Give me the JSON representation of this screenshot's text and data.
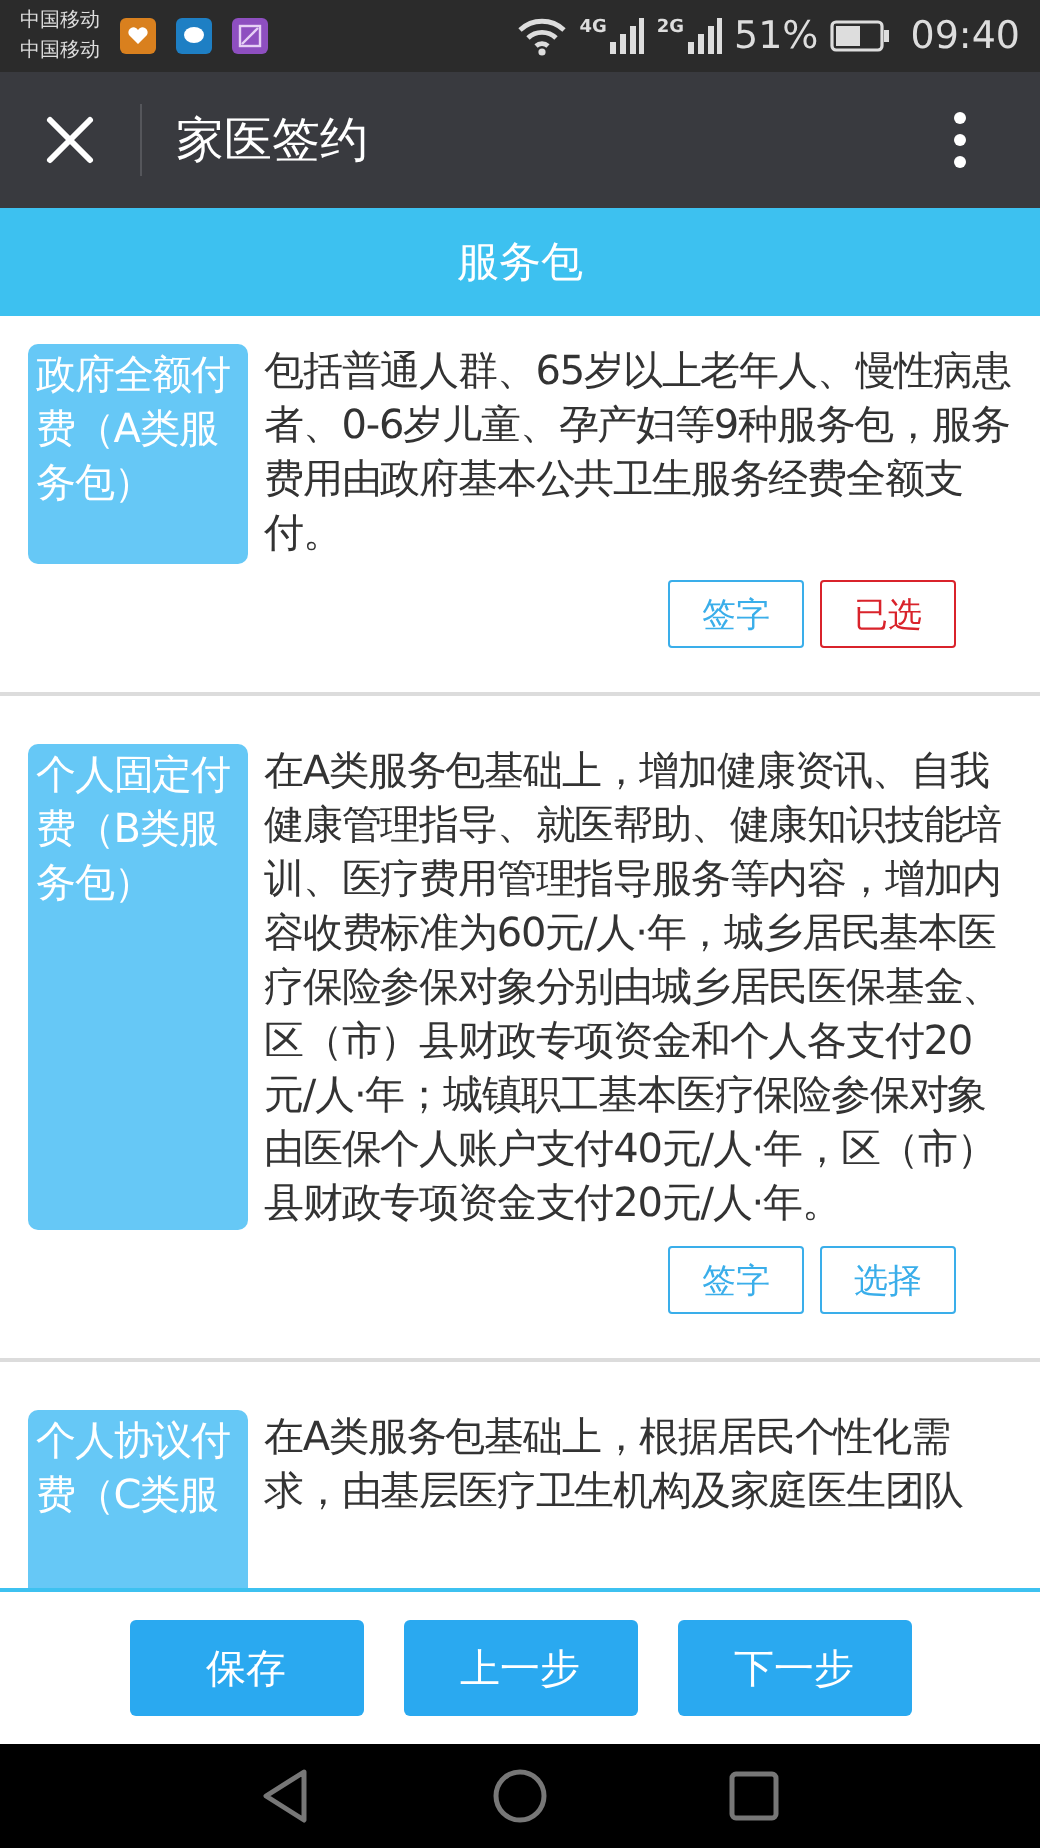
{
  "status_bar": {
    "carriers": [
      "中国移动",
      "中国移动"
    ],
    "network_1": "4G",
    "network_2": "2G",
    "battery": "51%",
    "time": "09:40"
  },
  "header": {
    "title": "家医签约"
  },
  "section_title": "服务包",
  "packages": [
    {
      "label": "政府全额付费（A类服务包）",
      "description": "包括普通人群、65岁以上老年人、慢性病患者、0-6岁儿童、孕产妇等9种服务包，服务费用由政府基本公共卫生服务经费全额支付。",
      "sign_button": "签字",
      "select_button": {
        "label": "已选",
        "selected": true
      }
    },
    {
      "label": "个人固定付费（B类服务包）",
      "description": "在A类服务包基础上，增加健康资讯、自我健康管理指导、就医帮助、健康知识技能培训、医疗费用管理指导服务等内容，增加内容收费标准为60元/人·年，城乡居民基本医疗保险参保对象分别由城乡居民医保基金、区（市）县财政专项资金和个人各支付20元/人·年；城镇职工基本医疗保险参保对象由医保个人账户支付40元/人·年，区（市）县财政专项资金支付20元/人·年。",
      "sign_button": "签字",
      "select_button": {
        "label": "选择",
        "selected": false
      }
    },
    {
      "label": "个人协议付费（C类服",
      "description": "在A类服务包基础上，根据居民个性化需求，由基层医疗卫生机构及家庭医生团队"
    }
  ],
  "footer_buttons": [
    "保存",
    "上一步",
    "下一步"
  ]
}
